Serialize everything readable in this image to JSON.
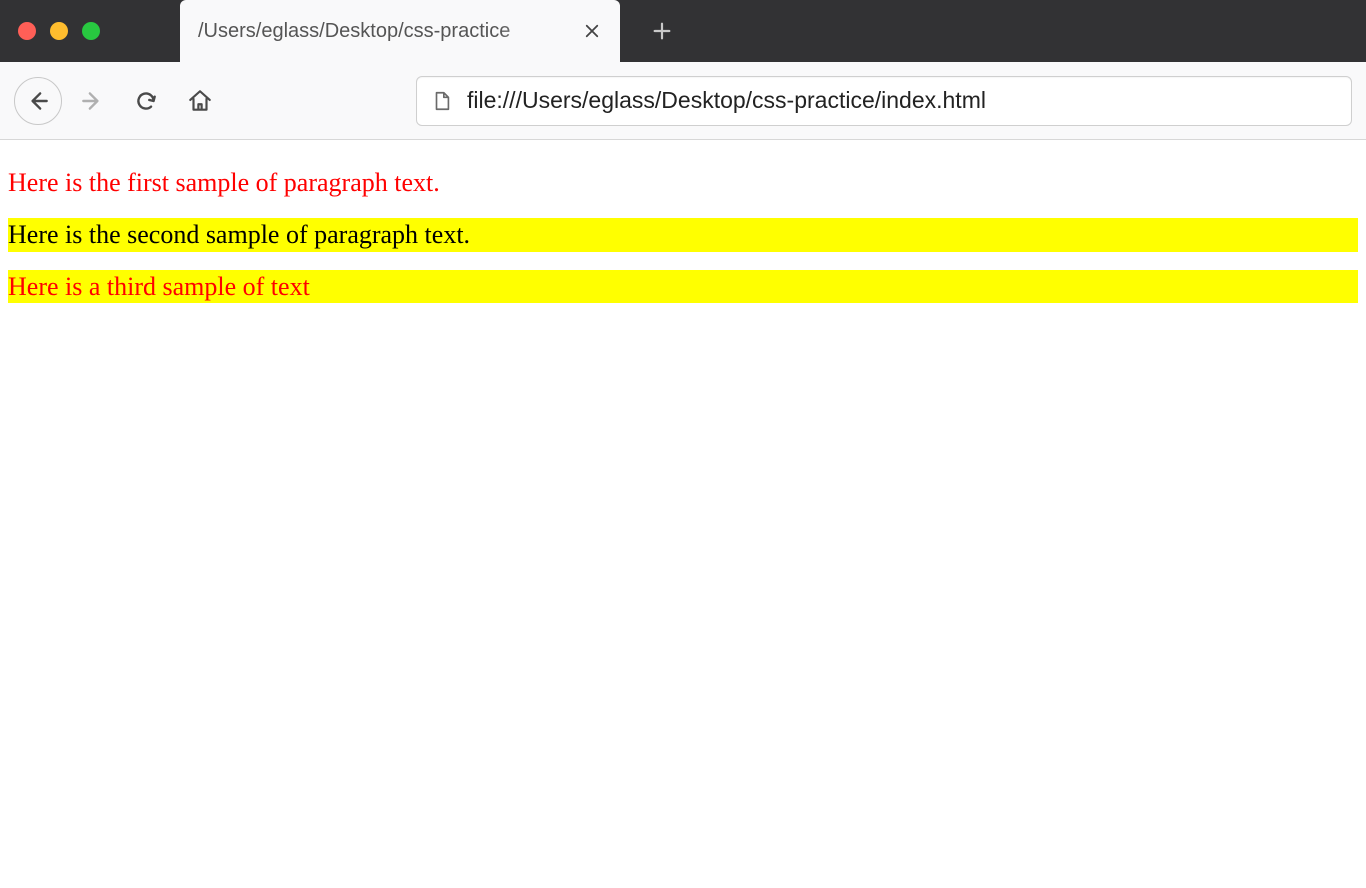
{
  "window": {
    "tab_title": "/Users/eglass/Desktop/css-practice",
    "url": "file:///Users/eglass/Desktop/css-practice/index.html"
  },
  "content": {
    "paragraph1": "Here is the first sample of paragraph text.",
    "paragraph2": "Here is the second sample of paragraph text.",
    "paragraph3": "Here is a third sample of text"
  },
  "colors": {
    "text_red": "#ff0000",
    "bg_yellow": "#ffff00",
    "text_black": "#000000"
  }
}
